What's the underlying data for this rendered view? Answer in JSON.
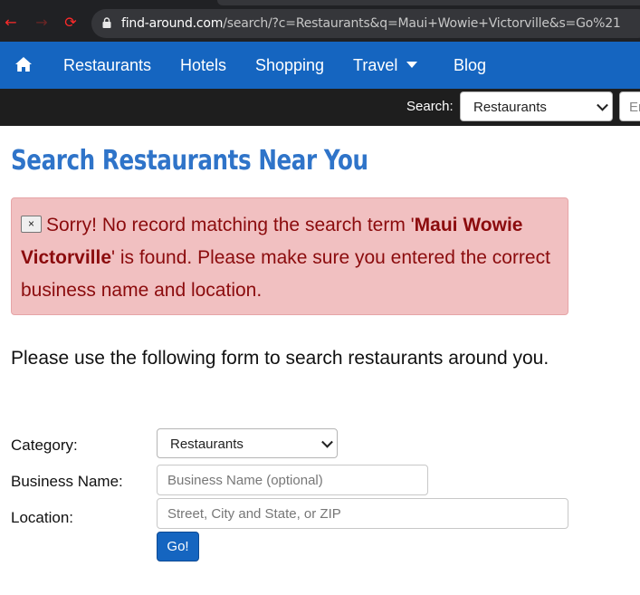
{
  "browser": {
    "url_host": "find-around.com",
    "url_path": "/search/?c=Restaurants&q=Maui+Wowie+Victorville&s=Go%21"
  },
  "nav": {
    "items": [
      {
        "label": "Restaurants"
      },
      {
        "label": "Hotels"
      },
      {
        "label": "Shopping"
      },
      {
        "label": "Travel"
      },
      {
        "label": "Blog"
      }
    ]
  },
  "searchbar": {
    "label": "Search:",
    "category_value": "Restaurants",
    "input_placeholder": "Er"
  },
  "main": {
    "title": "Search Restaurants Near You",
    "alert": {
      "close_glyph": "×",
      "text_before": "Sorry! No record matching the search term '",
      "term": "Maui Wowie Victorville",
      "text_after": "' is found. Please make sure you entered the correct business name and location."
    },
    "intro": "Please use the following form to search restaurants around you."
  },
  "form": {
    "category_label": "Category:",
    "category_value": "Restaurants",
    "business_label": "Business Name:",
    "business_placeholder": "Business Name (optional)",
    "location_label": "Location:",
    "location_placeholder": "Street, City and State, or ZIP",
    "submit_label": "Go!"
  },
  "colors": {
    "nav_bg": "#1565c0",
    "title": "#2f74c9",
    "alert_bg": "#f1c0c1",
    "alert_text": "#8b0b0d"
  }
}
